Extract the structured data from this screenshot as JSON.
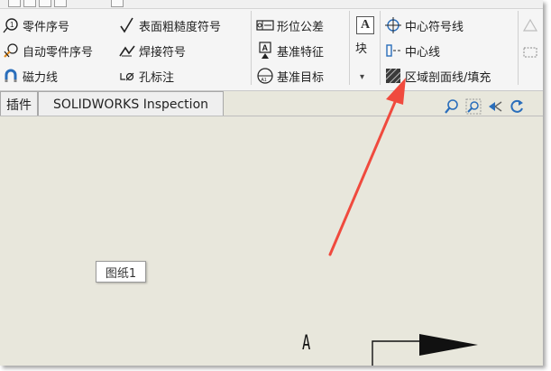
{
  "ribbon": {
    "col1": {
      "balloon": "零件序号",
      "auto_balloon": "自动零件序号",
      "magnetic_line": "磁力线"
    },
    "col2": {
      "surface_finish": "表面粗糙度符号",
      "weld_symbol": "焊接符号",
      "hole_callout": "孔标注"
    },
    "col3": {
      "geometric_tolerance": "形位公差",
      "datum_feature": "基准特征",
      "datum_target": "基准目标"
    },
    "block": {
      "label": "块",
      "dropdown": "▾"
    },
    "col4": {
      "center_mark": "中心符号线",
      "centerline": "中心线",
      "area_hatch": "区域剖面线/填充"
    }
  },
  "tabs": [
    {
      "label": "插件"
    },
    {
      "label": "SOLIDWORKS Inspection"
    }
  ],
  "canvas": {
    "sheet_label": "图纸1",
    "view_letter": "A"
  },
  "colors": {
    "accent_arrow": "#f04a3e",
    "canvas_bg": "#e8e7dc",
    "ribbon_bg": "#f5f5f5",
    "icon_blue": "#2a6ebb"
  }
}
